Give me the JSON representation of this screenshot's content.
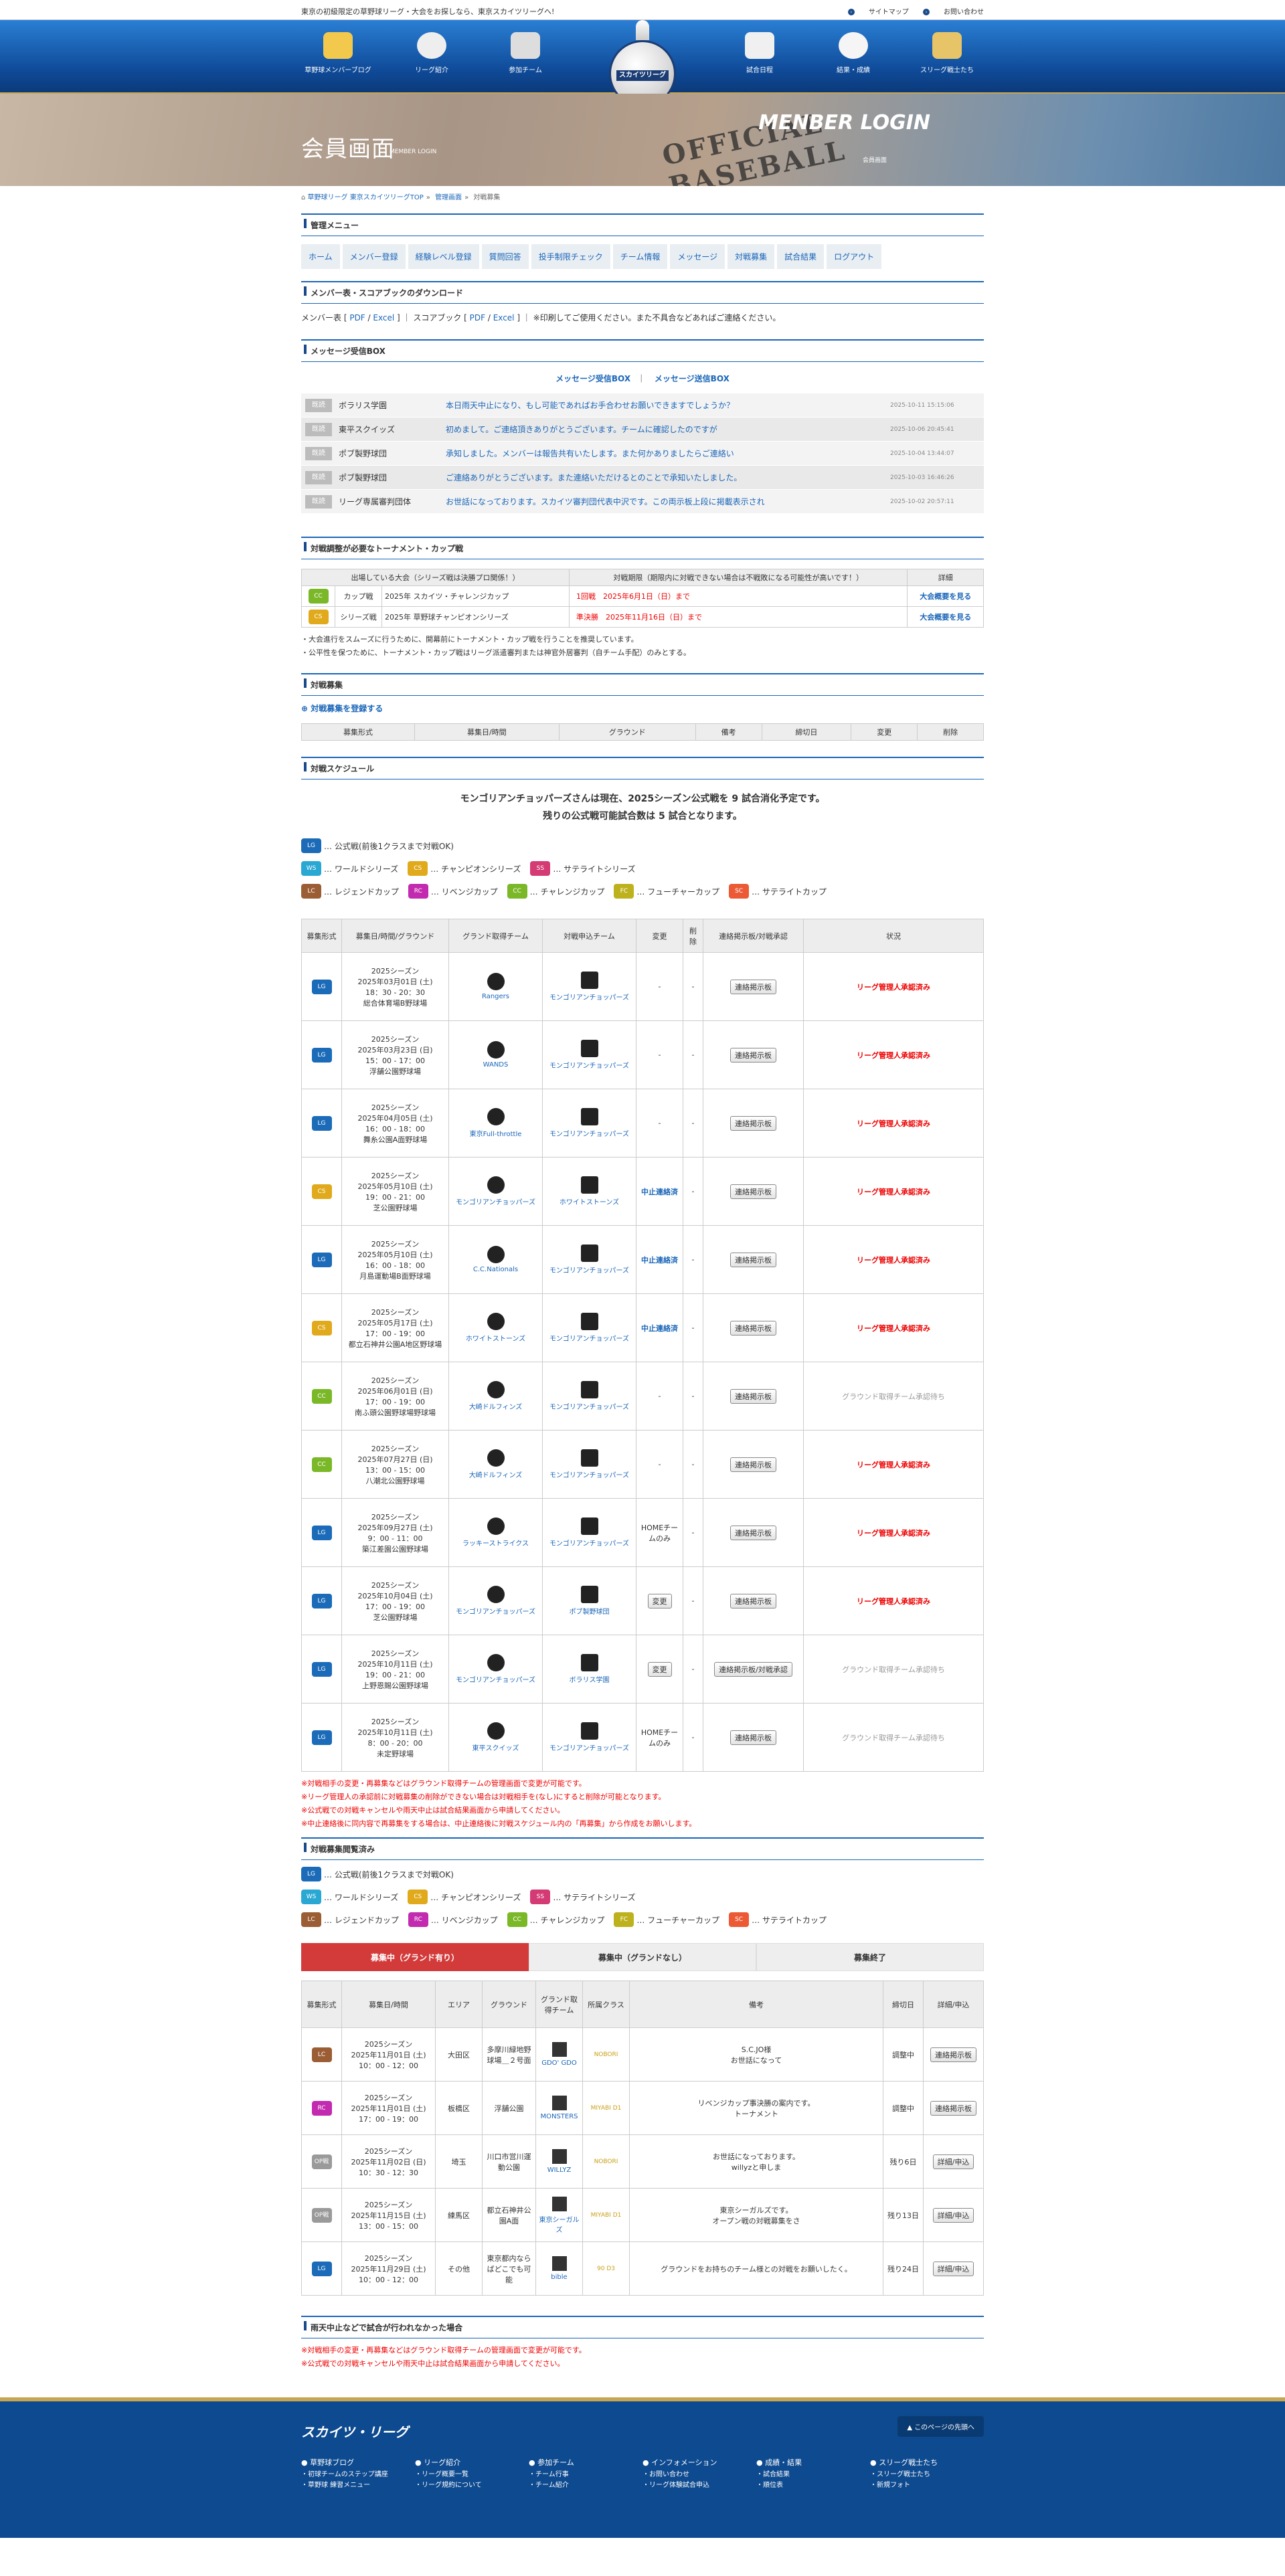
{
  "topbar": {
    "tagline": "東京の初級限定の草野球リーグ・大会をお探しなら、東京スカイツリーグへ!",
    "sitemap": "サイトマップ",
    "contact": "お問い合わせ"
  },
  "nav": {
    "items": [
      "草野球メンバーブログ",
      "リーグ紹介",
      "参加チーム",
      "試合日程",
      "結果・成績",
      "スリーグ戦士たち"
    ],
    "logo_text": "スカイツリーグ"
  },
  "hero": {
    "title": "会員画面",
    "title_sub": "MEMBER LOGIN",
    "en_title": "MENBER LOGIN",
    "en_sub": "会員画面",
    "ball_text": "OFFICIAL BASEBALL"
  },
  "breadcrumb": [
    "草野球リーグ 東京スカイツリーグTOP",
    "管理画面",
    "対戦募集"
  ],
  "manage_menu": {
    "title": "管理メニュー",
    "items": [
      "ホーム",
      "メンバー登録",
      "経験レベル登録",
      "質問回答",
      "投手制限チェック",
      "チーム情報",
      "メッセージ",
      "対戦募集",
      "試合結果",
      "ログアウト"
    ]
  },
  "download": {
    "title": "メンバー表・スコアブックのダウンロード",
    "text_before": "メンバー表 [",
    "pdf": "PDF",
    "excel": "Excel",
    "text_mid": "] ｜ スコアブック [",
    "text_after": "] ｜ ※印刷してご使用ください。また不具合などあればご連絡ください。"
  },
  "messages": {
    "title": "メッセージ受信BOX",
    "inbox": "メッセージ受信BOX",
    "outbox": "メッセージ送信BOX",
    "rows": [
      {
        "badge": "既読",
        "from": "ボラリス学園",
        "text": "本日雨天中止になり、もし可能であればお手合わせお願いできますでしょうか？",
        "date": "2025-10-11 15:15:06"
      },
      {
        "badge": "既読",
        "from": "東平スクイッズ",
        "text": "初めまして。ご連絡頂きありがとうございます。チームに確認したのですが",
        "date": "2025-10-06 20:45:41"
      },
      {
        "badge": "既読",
        "from": "ポブ製野球団",
        "text": "承知しました。メンバーは報告共有いたします。また何かありましたらご連絡い",
        "date": "2025-10-04 13:44:07"
      },
      {
        "badge": "既読",
        "from": "ポブ製野球団",
        "text": "ご連絡ありがとうございます。また連絡いただけるとのことで承知いたしました。",
        "date": "2025-10-03 16:46:26"
      },
      {
        "badge": "既読",
        "from": "リーグ専属審判団体",
        "text": "お世話になっております。スカイツ審判団代表中沢です。この両示板上段に掲載表示され",
        "date": "2025-10-02 20:57:11"
      }
    ]
  },
  "tournament": {
    "title": "対戦調整が必要なトーナメント・カップ戦",
    "headers": [
      "出場している大会（シリーズ戦は決勝プロ関係！）",
      "対戦期限（期限内に対戦できない場合は不戦敗になる可能性が高いです！）",
      "詳細"
    ],
    "rows": [
      {
        "badge": "CC",
        "type": "カップ戦",
        "name": "2025年 スカイツ・チャレンジカップ",
        "round": "1回戦",
        "deadline": "2025年6月1日（日）まで",
        "link": "大会概要を見る"
      },
      {
        "badge": "CS",
        "type": "シリーズ戦",
        "name": "2025年 草野球チャンピオンシリーズ",
        "round": "準決勝",
        "deadline": "2025年11月16日（日）まで",
        "link": "大会概要を見る"
      }
    ],
    "notes": [
      "・大会進行をスムーズに行うために、開幕前にトーナメント・カップ戦を行うことを推奨しています。",
      "・公平性を保つために、トーナメント・カップ戦はリーグ派遣審判または神官外居審判（自チーム手配）のみとする。"
    ]
  },
  "recruit": {
    "title": "対戦募集",
    "register": "対戦募集を登録する",
    "headers": [
      "募集形式",
      "募集日/時間",
      "グラウンド",
      "備考",
      "締切日",
      "変更",
      "削除"
    ]
  },
  "schedule": {
    "title": "対戦スケジュール",
    "headline1": "モンゴリアンチョッパーズさんは現在、2025シーズン公式戦を 9 試合消化予定です。",
    "headline2": "残りの公式戦可能試合数は 5 試合となります。",
    "legend": {
      "lg": "… 公式戦(前後1クラスまで対戦OK)",
      "ws": "… ワールドシリーズ",
      "cs": "… チャンピオンシリーズ",
      "ss": "… サテライトシリーズ",
      "lc": "… レジェンドカップ",
      "rc": "… リベンジカップ",
      "cc": "… チャレンジカップ",
      "fc": "… フューチャーカップ",
      "sc": "… サテライトカップ"
    },
    "headers": [
      "募集形式",
      "募集日/時間/グラウンド",
      "グランド取得チーム",
      "対戦申込チーム",
      "変更",
      "削除",
      "連絡掲示板/対戦承認",
      "状況"
    ],
    "rows": [
      {
        "badge": "LG",
        "season": "2025シーズン",
        "date": "2025年03月01日 (土)",
        "time": "18：30 - 20：30",
        "ground": "総合体育場B野球場",
        "home": "Rangers",
        "away": "モンゴリアンチョッパーズ",
        "change": "-",
        "del": "-",
        "board": "連絡掲示板",
        "status": "リーグ管理人承認済み",
        "st": "r"
      },
      {
        "badge": "LG",
        "season": "2025シーズン",
        "date": "2025年03月23日 (日)",
        "time": "15：00 - 17：00",
        "ground": "浮舗公園野球場",
        "home": "WANDS",
        "away": "モンゴリアンチョッパーズ",
        "change": "-",
        "del": "-",
        "board": "連絡掲示板",
        "status": "リーグ管理人承認済み",
        "st": "r"
      },
      {
        "badge": "LG",
        "season": "2025シーズン",
        "date": "2025年04月05日 (土)",
        "time": "16：00 - 18：00",
        "ground": "舞糸公園A面野球場",
        "home": "東京Full-throttle",
        "away": "モンゴリアンチョッパーズ",
        "change": "-",
        "del": "-",
        "board": "連絡掲示板",
        "status": "リーグ管理人承認済み",
        "st": "r"
      },
      {
        "badge": "CS",
        "season": "2025シーズン",
        "date": "2025年05月10日 (土)",
        "time": "19：00 - 21：00",
        "ground": "芝公園野球場",
        "home": "モンゴリアンチョッパーズ",
        "away": "ホワイトストーンズ",
        "change": "中止連絡済",
        "del": "-",
        "board": "連絡掲示板",
        "status": "リーグ管理人承認済み",
        "st": "r"
      },
      {
        "badge": "LG",
        "season": "2025シーズン",
        "date": "2025年05月10日 (土)",
        "time": "16：00 - 18：00",
        "ground": "月島運動場B面野球場",
        "home": "C.C.Nationals",
        "away": "モンゴリアンチョッパーズ",
        "change": "中止連絡済",
        "del": "-",
        "board": "連絡掲示板",
        "status": "リーグ管理人承認済み",
        "st": "r"
      },
      {
        "badge": "CS",
        "season": "2025シーズン",
        "date": "2025年05月17日 (土)",
        "time": "17：00 - 19：00",
        "ground": "都立石神井公園A地区野球場",
        "home": "ホワイトストーンズ",
        "away": "モンゴリアンチョッパーズ",
        "change": "中止連絡済",
        "del": "-",
        "board": "連絡掲示板",
        "status": "リーグ管理人承認済み",
        "st": "r"
      },
      {
        "badge": "CC",
        "season": "2025シーズン",
        "date": "2025年06月01日 (日)",
        "time": "17：00 - 19：00",
        "ground": "南ふ頭公園野球場野球場",
        "home": "大崎ドルフィンズ",
        "away": "モンゴリアンチョッパーズ",
        "change": "-",
        "del": "-",
        "board": "連絡掲示板",
        "status": "グラウンド取得チーム承認待ち",
        "st": "g"
      },
      {
        "badge": "CC",
        "season": "2025シーズン",
        "date": "2025年07月27日 (日)",
        "time": "13：00 - 15：00",
        "ground": "八潮北公園野球場",
        "home": "大崎ドルフィンズ",
        "away": "モンゴリアンチョッパーズ",
        "change": "-",
        "del": "-",
        "board": "連絡掲示板",
        "status": "リーグ管理人承認済み",
        "st": "r"
      },
      {
        "badge": "LG",
        "season": "2025シーズン",
        "date": "2025年09月27日 (土)",
        "time": "9：00 - 11：00",
        "ground": "築江差園公園野球場",
        "home": "ラッキーストライクス",
        "away": "モンゴリアンチョッパーズ",
        "change": "HOMEチームのみ",
        "del": "-",
        "board": "連絡掲示板",
        "status": "リーグ管理人承認済み",
        "st": "r"
      },
      {
        "badge": "LG",
        "season": "2025シーズン",
        "date": "2025年10月04日 (土)",
        "time": "17：00 - 19：00",
        "ground": "芝公園野球場",
        "home": "モンゴリアンチョッパーズ",
        "away": "ポブ製野球団",
        "change": "変更",
        "del": "-",
        "board": "連絡掲示板",
        "status": "リーグ管理人承認済み",
        "st": "r"
      },
      {
        "badge": "LG",
        "season": "2025シーズン",
        "date": "2025年10月11日 (土)",
        "time": "19：00 - 21：00",
        "ground": "上野恩賜公園野球場",
        "home": "モンゴリアンチョッパーズ",
        "away": "ボラリス学園",
        "change": "変更",
        "del": "-",
        "board": "連絡掲示板/対戦承認",
        "status": "グラウンド取得チーム承認待ち",
        "st": "g"
      },
      {
        "badge": "LG",
        "season": "2025シーズン",
        "date": "2025年10月11日 (土)",
        "time": "8：00 - 20：00",
        "ground": "未定野球場",
        "home": "東平スクイッズ",
        "away": "モンゴリアンチョッパーズ",
        "change": "HOMEチームのみ",
        "del": "-",
        "board": "連絡掲示板",
        "status": "グラウンド取得チーム承認待ち",
        "st": "g"
      }
    ],
    "notes": [
      "※対戦相手の変更・再募集などはグラウンド取得チームの管理画面で変更が可能です。",
      "※リーグ管理人の承認前に対戦募集の削除ができない場合は対戦相手を(なし)にすると削除が可能となります。",
      "※公式戦での対戦キャンセルや雨天中止は試合結果画面から申請してください。",
      "※中止連絡後に同内容で再募集をする場合は、中止連絡後に対戦スケジュール内の「再募集」から作成をお願いします。"
    ]
  },
  "listing": {
    "title": "対戦募集閲覧済み",
    "tabs": [
      "募集中（グランド有り）",
      "募集中（グランドなし）",
      "募集終了"
    ],
    "headers": [
      "募集形式",
      "募集日/時間",
      "エリア",
      "グラウンド",
      "グランド取得チーム",
      "所属クラス",
      "備考",
      "締切日",
      "詳細/申込"
    ],
    "rows": [
      {
        "badge": "LC",
        "season": "2025シーズン",
        "date": "2025年11月01日 (土)",
        "time": "10：00 - 12：00",
        "area": "大田区",
        "ground": "多摩川緑地野球場＿２号面",
        "team": "GDO' GDO",
        "cls": "NOBORI",
        "note": "S.C.JO様\nお世話になって",
        "deadline": "調整中",
        "btn": "連絡掲示板"
      },
      {
        "badge": "RC",
        "season": "2025シーズン",
        "date": "2025年11月01日 (土)",
        "time": "17：00 - 19：00",
        "area": "板橋区",
        "ground": "浮舗公園",
        "team": "MONSTERS",
        "cls": "MIYABI D1",
        "note": "リベンジカップ事決勝の案内です。\nトーナメント",
        "deadline": "調整中",
        "btn": "連絡掲示板"
      },
      {
        "badge": "OP戦",
        "season": "2025シーズン",
        "date": "2025年11月02日 (日)",
        "time": "10：30 - 12：30",
        "area": "埼玉",
        "ground": "川口市営川運動公園",
        "team": "WILLYZ",
        "cls": "NOBORI",
        "note": "お世話になっております。\nwillyzと申しま",
        "deadline": "残り6日",
        "btn": "詳細/申込"
      },
      {
        "badge": "OP戦",
        "season": "2025シーズン",
        "date": "2025年11月15日 (土)",
        "time": "13：00 - 15：00",
        "area": "練馬区",
        "ground": "都立石神井公園A面",
        "team": "東京シーガルズ",
        "cls": "MIYABI D1",
        "note": "東京シーガルズです。\nオープン戦の対戦募集をさ",
        "deadline": "残り13日",
        "btn": "詳細/申込"
      },
      {
        "badge": "LG",
        "season": "2025シーズン",
        "date": "2025年11月29日 (土)",
        "time": "10：00 - 12：00",
        "area": "その他",
        "ground": "東京都内ならばどこでも可能",
        "team": "bible",
        "cls": "90 D3",
        "note": "グラウンドをお持ちのチーム様との対戦をお願いしたく。",
        "deadline": "残り24日",
        "btn": "詳細/申込"
      }
    ]
  },
  "rain": {
    "title": "雨天中止などで試合が行われなかった場合",
    "notes": [
      "※対戦相手の変更・再募集などはグラウンド取得チームの管理画面で変更が可能です。",
      "※公式戦での対戦キャンセルや雨天中止は試合結果画面から申請してください。"
    ]
  },
  "footer": {
    "logo": "スカイツ・リーグ",
    "to_top": "このページの先頭へ",
    "cols": [
      {
        "title": "草野球ブログ",
        "items": [
          "初球チームのステップ講座",
          "草野球 練習メニュー"
        ]
      },
      {
        "title": "リーグ紹介",
        "items": [
          "リーグ概要一覧",
          "リーグ規約について"
        ]
      },
      {
        "title": "参加チーム",
        "items": [
          "チーム行事",
          "チーム紹介"
        ]
      },
      {
        "title": "インフォメーション",
        "items": [
          "お問い合わせ",
          "リーグ体験試合申込"
        ]
      },
      {
        "title": "成績・結果",
        "items": [
          "試合結果",
          "順位表"
        ]
      },
      {
        "title": "スリーグ戦士たち",
        "items": [
          "スリーグ戦士たち",
          "新規フォト"
        ]
      }
    ]
  }
}
